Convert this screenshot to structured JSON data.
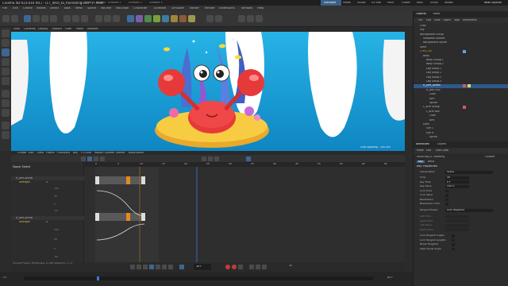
{
  "window": {
    "title": "Cinema 4D R23.010 (RC) - [17_Intro_to_Animating.c4d *] - Main",
    "tabs": [
      "17_Intro_to_Animat...",
      "Untitled 1",
      "Untitled 2",
      "Untitled 3"
    ]
  },
  "menubar": {
    "items": [
      "File",
      "Edit",
      "Create",
      "Modes",
      "Select",
      "Tools",
      "Mesh",
      "Spline",
      "Volume",
      "MoGraph",
      "Character",
      "Animate",
      "Simulate",
      "Tracker",
      "Render",
      "Extensions",
      "Window",
      "Help"
    ]
  },
  "layouts": {
    "items": [
      "Standard",
      "Model",
      "Sculpt",
      "UV Edit",
      "Paint",
      "Groom",
      "Track",
      "Script",
      "Nodes",
      "Spline"
    ],
    "new_layouts": "New Layouts"
  },
  "viewport": {
    "menu": [
      "View",
      "Cameras",
      "Display",
      "Options",
      "Filter",
      "Panel",
      "Redshift"
    ],
    "grid_spacing": "Grid Spacing : 100 cm"
  },
  "timeline": {
    "menu": [
      "Create",
      "Edit",
      "View",
      "Frame",
      "Functions",
      "Key",
      "F-Curve",
      "Motion System",
      "Marker",
      "Bookmarks"
    ],
    "mode_label": "Dope Sheet",
    "ruler": [
      "0",
      "5",
      "10",
      "15",
      "20",
      "25",
      "30",
      "35",
      "40",
      "45",
      "50",
      "55",
      "60",
      "65",
      "70",
      "75",
      "80"
    ],
    "tracks": [
      {
        "object": "R_Arm.Animk",
        "param": "Strength",
        "value": "0"
      },
      {
        "object": "R_Arm.Animk",
        "param": "Strength",
        "value": "0"
      }
    ],
    "curve_labels": [
      "100",
      "50",
      "0",
      "-50",
      "100",
      "50",
      "0",
      "-50"
    ],
    "status": "Current Frame: 18  Preview: 0->80  Selection: 1->1"
  },
  "transport": {
    "frame": "18 F",
    "fps": "30",
    "start": "0 F",
    "end": "80 F"
  },
  "objects_panel": {
    "tabs": [
      "Objects",
      "Takes"
    ],
    "menu": [
      "File",
      "Edit",
      "View",
      "Object",
      "Tags",
      "Bookmarks"
    ],
    "items": [
      "Crab",
      "Sky",
      "Background Group",
      "Seaweed Flowers",
      "Background Spline",
      "Sand",
      "Crab_Grp",
      "Body",
      "Body Group 1",
      "Body Group 2",
      "Leg Group 1",
      "Leg Group 2",
      "Leg Group 3",
      "Leg Group 4",
      "R_Arm_Animk",
      "R_Arm Null",
      "Claw",
      "Arm",
      "Spline",
      "L_Arm Group",
      "L_Arm Null",
      "Claw",
      "Arm",
      "Eyes",
      "Eye L",
      "Eye R",
      "Spline"
    ]
  },
  "attributes_panel": {
    "tabs": [
      "Attributes",
      "Layers"
    ],
    "menu": [
      "Mode",
      "Edit",
      "User Data"
    ],
    "header": "Value Key [1 Element]",
    "mode": "Custom",
    "tabs2": [
      "Key",
      "Basic"
    ],
    "section": "Key Properties",
    "fields": [
      {
        "label": "Interpolation",
        "value": "Spline"
      },
      {
        "label": "Time",
        "value": "18"
      },
      {
        "label": "Key Time",
        "value": "0 F"
      },
      {
        "label": "Key Value",
        "value": "100 %"
      },
      {
        "label": "Lock Time",
        "value": ""
      },
      {
        "label": "Lock Value",
        "value": ""
      },
      {
        "label": "Breakdown",
        "value": ""
      },
      {
        "label": "Breakdown Color",
        "value": ""
      },
      {
        "label": "Tangent Preset",
        "value": "Auto Weighted"
      },
      {
        "label": "Left Time",
        "value": ""
      },
      {
        "label": "Right Time",
        "value": ""
      },
      {
        "label": "Left Value",
        "value": ""
      },
      {
        "label": "Right Value",
        "value": ""
      },
      {
        "label": "Lock Tangent Angles",
        "value": ""
      },
      {
        "label": "Lock Tangent Lengths",
        "value": ""
      },
      {
        "label": "Break Tangents",
        "value": ""
      },
      {
        "label": "Keep Visual Angle",
        "value": ""
      }
    ]
  },
  "colors": {
    "accent_blue": "#2d5a8c",
    "key_orange": "#e58a1f",
    "viewport_sky": "#17a0d8",
    "playhead": "#3a7bd5"
  }
}
